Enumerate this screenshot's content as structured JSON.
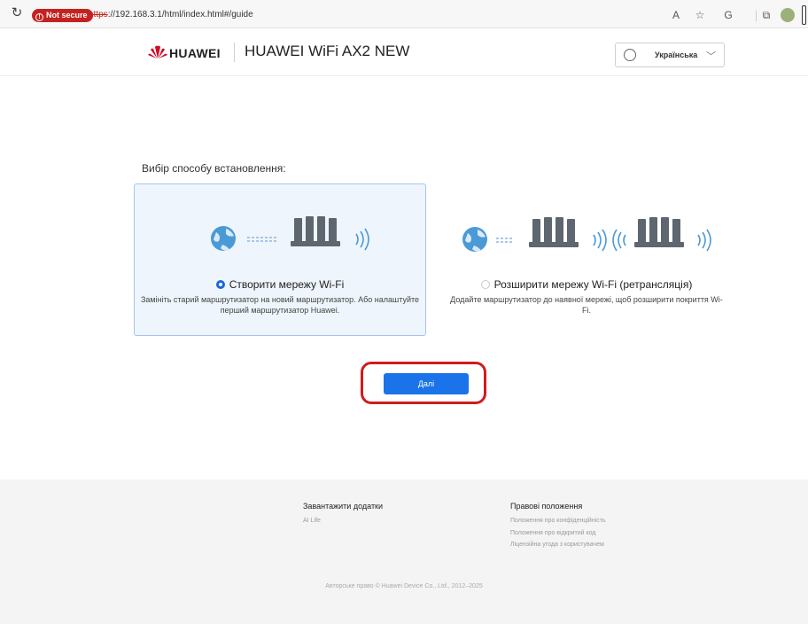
{
  "browser": {
    "security_label": "Not secure",
    "url_protocol": "https",
    "url_rest": "://192.168.3.1/html/index.html#/guide"
  },
  "header": {
    "brand": "HUAWEI",
    "product": "HUAWEI WiFi AX2 NEW",
    "language": "Українська",
    "brand_color": "#cf0a2c"
  },
  "main": {
    "title": "Вибір способу встановлення:",
    "options": [
      {
        "label": "Створити мережу Wi-Fi",
        "description": "Замініть старий маршрутизатор на новий маршрутизатор. Або налаштуйте перший маршрутизатор Huawei.",
        "selected": true
      },
      {
        "label": "Розширити мережу Wi-Fi (ретрансляція)",
        "description": "Додайте маршрутизатор до наявної мережі, щоб розширити покриття Wi-Fi.",
        "selected": false
      }
    ],
    "next_label": "Далі",
    "accent_color": "#1a73e8"
  },
  "footer": {
    "downloads_title": "Завантажити додатки",
    "downloads_link": "AI Life",
    "legal_title": "Правові положення",
    "legal_links": [
      "Положення про конфіденційність",
      "Положення про відкритий код",
      "Ліцензійна угода з користувачем"
    ],
    "copyright": "Авторське право © Huawei Device Co., Ltd., 2012–2025"
  }
}
